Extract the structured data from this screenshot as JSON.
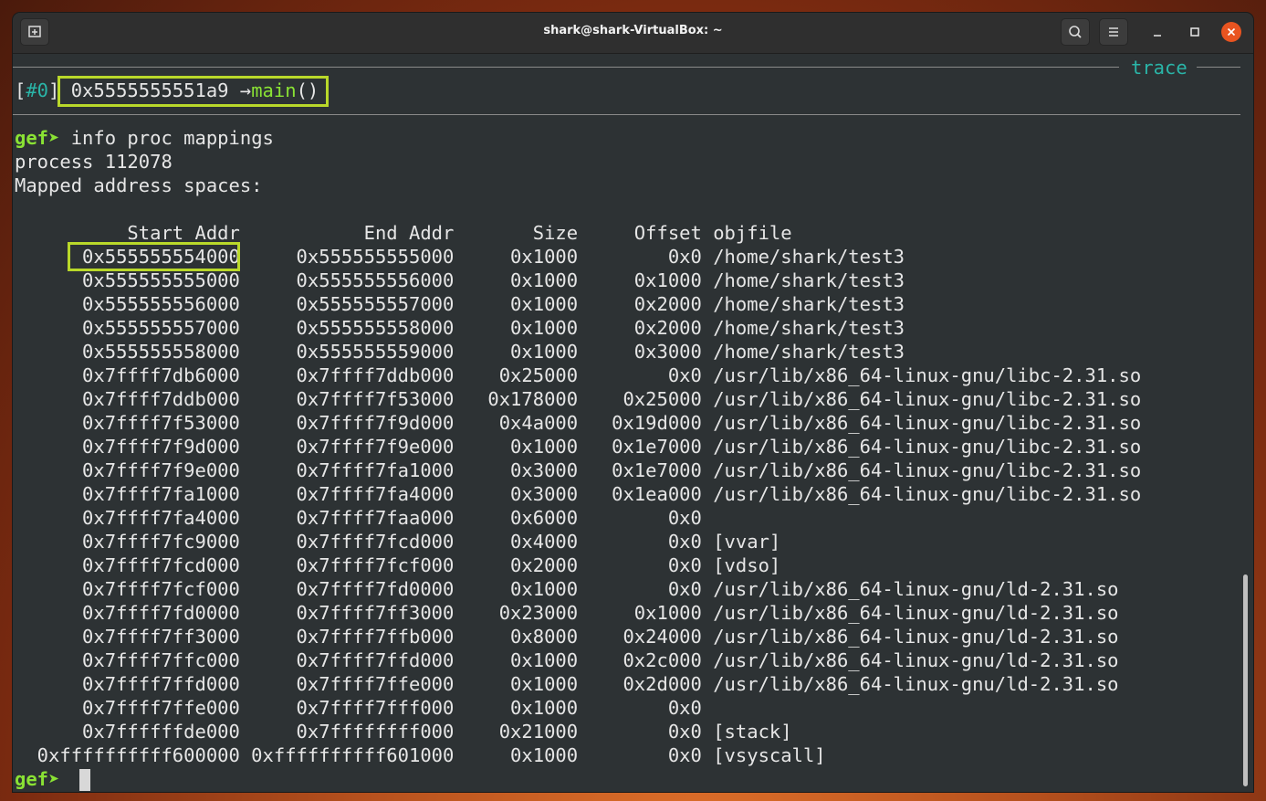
{
  "window": {
    "title": "shark@shark-VirtualBox: ~"
  },
  "icons": {
    "new_tab": "new-tab-icon",
    "search": "search-icon",
    "menu": "hamburger-menu-icon",
    "minimize": "minimize-icon",
    "maximize": "maximize-icon",
    "close": "close-icon"
  },
  "colors": {
    "highlight": "#b9d82a",
    "prompt": "#8ae234",
    "trace": "#2ab5a8",
    "close_button": "#e95420"
  },
  "terminal": {
    "trace_label": "trace",
    "frame": {
      "open": "[",
      "index": "#0",
      "close": "]",
      "address": "0x5555555551a9",
      "arrow": " →",
      "function": "main",
      "parens": "()"
    },
    "prompt": "gef➤",
    "command": " info proc mappings",
    "process_line": "process 112078",
    "mapped_line": "Mapped address spaces:",
    "table_header": "          Start Addr           End Addr       Size     Offset objfile",
    "mappings": [
      "      0x555555554000     0x555555555000     0x1000        0x0 /home/shark/test3",
      "      0x555555555000     0x555555556000     0x1000     0x1000 /home/shark/test3",
      "      0x555555556000     0x555555557000     0x1000     0x2000 /home/shark/test3",
      "      0x555555557000     0x555555558000     0x1000     0x2000 /home/shark/test3",
      "      0x555555558000     0x555555559000     0x1000     0x3000 /home/shark/test3",
      "      0x7ffff7db6000     0x7ffff7ddb000    0x25000        0x0 /usr/lib/x86_64-linux-gnu/libc-2.31.so",
      "      0x7ffff7ddb000     0x7ffff7f53000   0x178000    0x25000 /usr/lib/x86_64-linux-gnu/libc-2.31.so",
      "      0x7ffff7f53000     0x7ffff7f9d000    0x4a000   0x19d000 /usr/lib/x86_64-linux-gnu/libc-2.31.so",
      "      0x7ffff7f9d000     0x7ffff7f9e000     0x1000   0x1e7000 /usr/lib/x86_64-linux-gnu/libc-2.31.so",
      "      0x7ffff7f9e000     0x7ffff7fa1000     0x3000   0x1e7000 /usr/lib/x86_64-linux-gnu/libc-2.31.so",
      "      0x7ffff7fa1000     0x7ffff7fa4000     0x3000   0x1ea000 /usr/lib/x86_64-linux-gnu/libc-2.31.so",
      "      0x7ffff7fa4000     0x7ffff7faa000     0x6000        0x0",
      "      0x7ffff7fc9000     0x7ffff7fcd000     0x4000        0x0 [vvar]",
      "      0x7ffff7fcd000     0x7ffff7fcf000     0x2000        0x0 [vdso]",
      "      0x7ffff7fcf000     0x7ffff7fd0000     0x1000        0x0 /usr/lib/x86_64-linux-gnu/ld-2.31.so",
      "      0x7ffff7fd0000     0x7ffff7ff3000    0x23000     0x1000 /usr/lib/x86_64-linux-gnu/ld-2.31.so",
      "      0x7ffff7ff3000     0x7ffff7ffb000     0x8000    0x24000 /usr/lib/x86_64-linux-gnu/ld-2.31.so",
      "      0x7ffff7ffc000     0x7ffff7ffd000     0x1000    0x2c000 /usr/lib/x86_64-linux-gnu/ld-2.31.so",
      "      0x7ffff7ffd000     0x7ffff7ffe000     0x1000    0x2d000 /usr/lib/x86_64-linux-gnu/ld-2.31.so",
      "      0x7ffff7ffe000     0x7ffff7fff000     0x1000        0x0",
      "      0x7ffffffde000     0x7ffffffff000    0x21000        0x0 [stack]",
      "  0xffffffffff600000 0xffffffffff601000     0x1000        0x0 [vsyscall]"
    ]
  }
}
